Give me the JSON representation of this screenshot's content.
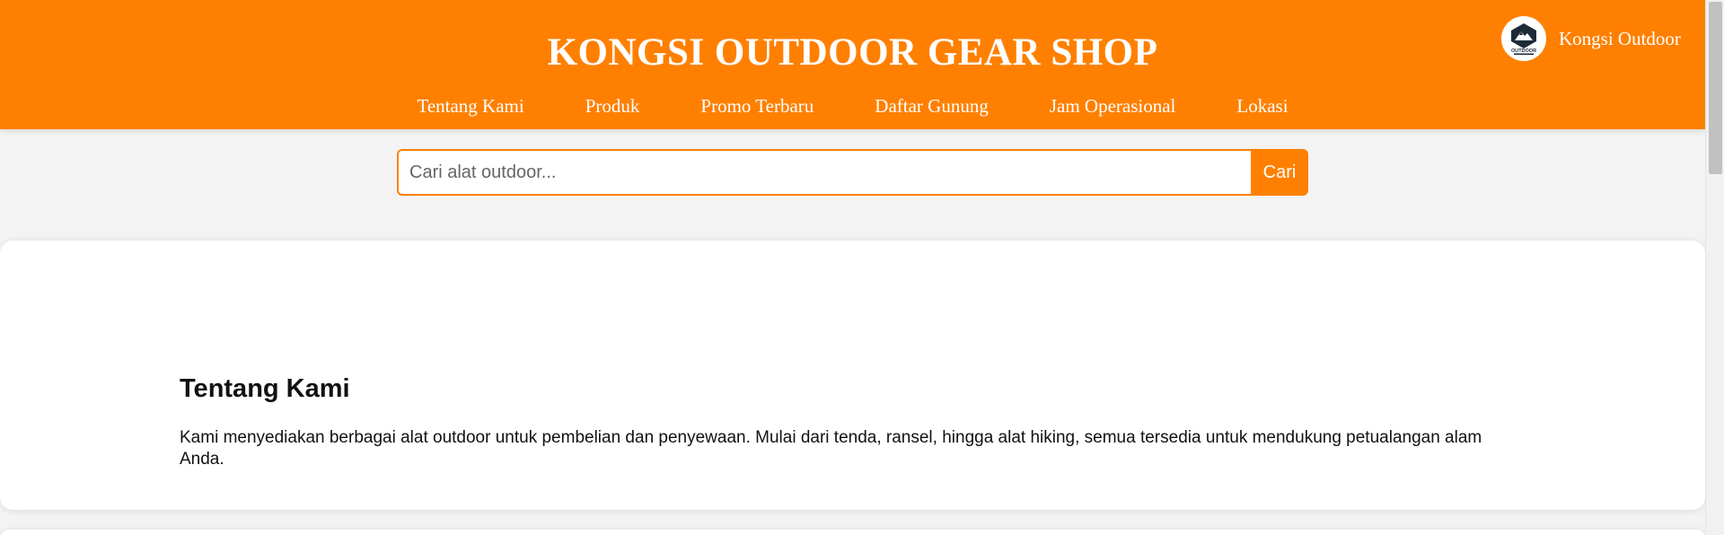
{
  "header": {
    "title": "KONGSI OUTDOOR GEAR SHOP",
    "brand_name": "Kongsi Outdoor",
    "brand_logo_text": "OUTDOOR",
    "nav": [
      {
        "label": "Tentang Kami"
      },
      {
        "label": "Produk"
      },
      {
        "label": "Promo Terbaru"
      },
      {
        "label": "Daftar Gunung"
      },
      {
        "label": "Jam Operasional"
      },
      {
        "label": "Lokasi"
      }
    ]
  },
  "search": {
    "placeholder": "Cari alat outdoor...",
    "value": "",
    "button_label": "Cari"
  },
  "about": {
    "title": "Tentang Kami",
    "text": "Kami menyediakan berbagai alat outdoor untuk pembelian dan penyewaan. Mulai dari tenda, ransel, hingga alat hiking, semua tersedia untuk mendukung petualangan alam Anda."
  },
  "colors": {
    "accent": "#ff8000",
    "background": "#f3f3f3",
    "card": "#ffffff"
  },
  "icons": {
    "brand_logo": "mountain-logo-icon"
  }
}
